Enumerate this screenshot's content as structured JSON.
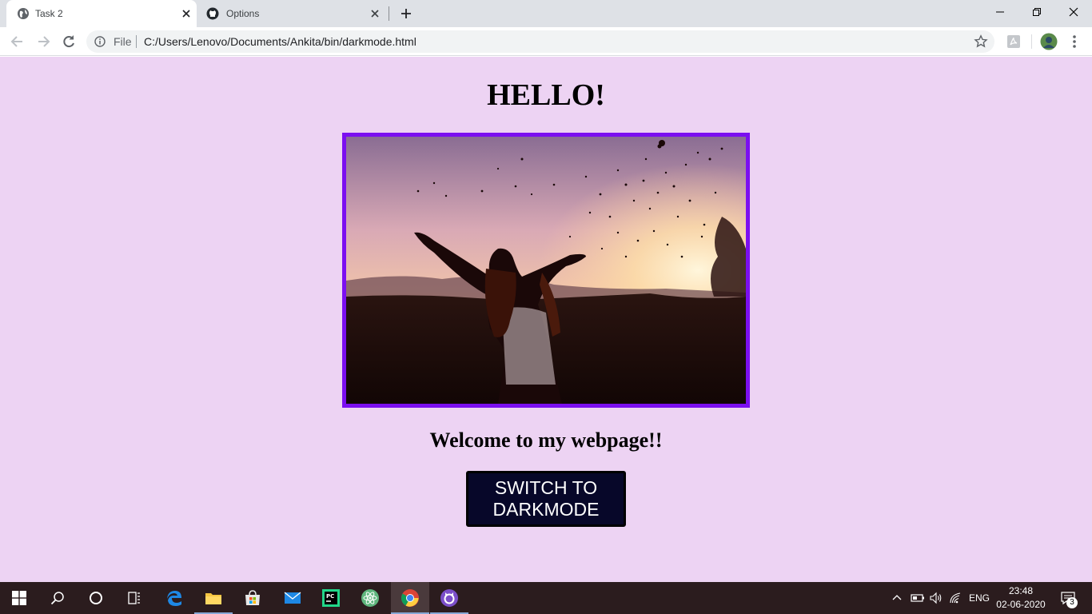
{
  "browser": {
    "tabs": [
      {
        "title": "Task 2",
        "active": true
      },
      {
        "title": "Options",
        "active": false
      }
    ],
    "address": {
      "scheme_label": "File",
      "url": "C:/Users/Lenovo/Documents/Ankita/bin/darkmode.html"
    }
  },
  "page": {
    "heading": "HELLO!",
    "welcome": "Welcome to my webpage!!",
    "button_line1": "SWITCH TO",
    "button_line2": "DARKMODE",
    "background_color": "#edd3f3",
    "image_border_color": "#7b0ff0",
    "button_color": "#070729"
  },
  "taskbar": {
    "apps": [
      "windows-start",
      "search",
      "cortana",
      "task-view",
      "edge",
      "file-explorer",
      "store",
      "mail",
      "pycharm",
      "atom",
      "chrome",
      "github-desktop"
    ],
    "active_app": "chrome",
    "language": "ENG",
    "time": "23:48",
    "date": "02-06-2020",
    "notification_count": "3"
  }
}
